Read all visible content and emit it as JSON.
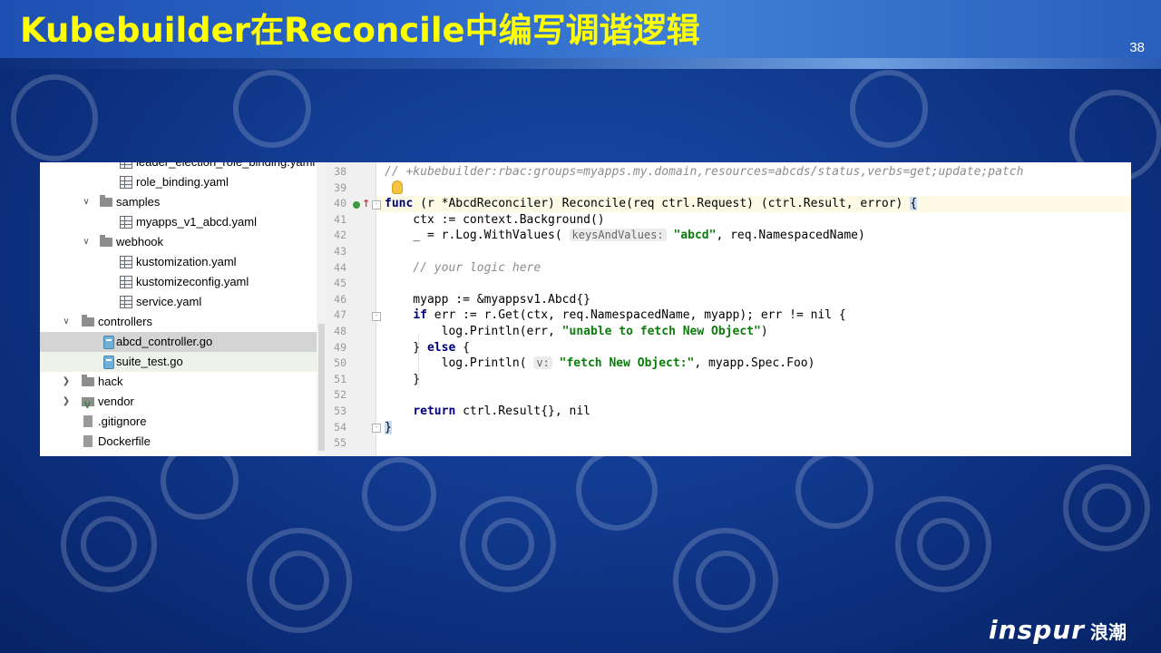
{
  "slide": {
    "title": "Kubebuilder在Reconcile中编写调谐逻辑",
    "page_number": "38",
    "logo_text": "inspur",
    "logo_cn": "浪潮"
  },
  "colors": {
    "title": "#ffff00",
    "background": "#123c92",
    "keyword": "#00007f",
    "string": "#0a7d0a",
    "comment": "#8c8c8c"
  },
  "project_tree": {
    "items": [
      {
        "label": "leader_election_role_binding.yaml",
        "type": "yaml",
        "state": "partially-visible"
      },
      {
        "label": "role_binding.yaml",
        "type": "yaml"
      },
      {
        "label": "samples",
        "type": "folder",
        "expanded": true
      },
      {
        "label": "myapps_v1_abcd.yaml",
        "type": "yaml"
      },
      {
        "label": "webhook",
        "type": "folder",
        "expanded": true
      },
      {
        "label": "kustomization.yaml",
        "type": "yaml"
      },
      {
        "label": "kustomizeconfig.yaml",
        "type": "yaml"
      },
      {
        "label": "service.yaml",
        "type": "yaml"
      },
      {
        "label": "controllers",
        "type": "folder",
        "expanded": true
      },
      {
        "label": "abcd_controller.go",
        "type": "go",
        "selected": true
      },
      {
        "label": "suite_test.go",
        "type": "go"
      },
      {
        "label": "hack",
        "type": "folder",
        "expanded": false
      },
      {
        "label": "vendor",
        "type": "vendor-folder",
        "expanded": false
      },
      {
        "label": ".gitignore",
        "type": "file"
      },
      {
        "label": "Dockerfile",
        "type": "file"
      }
    ]
  },
  "editor": {
    "line_numbers": [
      "38",
      "39",
      "40",
      "41",
      "42",
      "43",
      "44",
      "45",
      "46",
      "47",
      "48",
      "49",
      "50",
      "51",
      "52",
      "53",
      "54",
      "55"
    ],
    "lines": {
      "l38": "// +kubebuilder:rbac:groups=myapps.my.domain,resources=abcds/status,verbs=get;update;patch",
      "l40_kw": "func",
      "l40_rest": " (r *AbcdReconciler) Reconcile(req ctrl.Request) (ctrl.Result, error) ",
      "l40_brace": "{",
      "l41": "    ctx := context.Background()",
      "l42_pre": "    _ = r.Log.WithValues( ",
      "l42_hint": "keysAndValues:",
      "l42_str": "\"abcd\"",
      "l42_post": ", req.NamespacedName)",
      "l44": "    // your logic here",
      "l46": "    myapp := &myappsv1.Abcd{}",
      "l47_kw": "if",
      "l47_rest": " err := r.Get(ctx, req.NamespacedName, myapp); err != nil {",
      "l48_pre": "        log.Println(err, ",
      "l48_str": "\"unable to fetch New Object\"",
      "l48_post": ")",
      "l49_pre": "    } ",
      "l49_kw": "else",
      "l49_post": " {",
      "l50_pre": "        log.Println( ",
      "l50_hint": "v:",
      "l50_str": "\"fetch New Object:\"",
      "l50_post": ", myapp.Spec.Foo)",
      "l51": "    }",
      "l53_kw": "return",
      "l53_rest": " ctrl.Result{}, nil",
      "l54": "}"
    }
  }
}
